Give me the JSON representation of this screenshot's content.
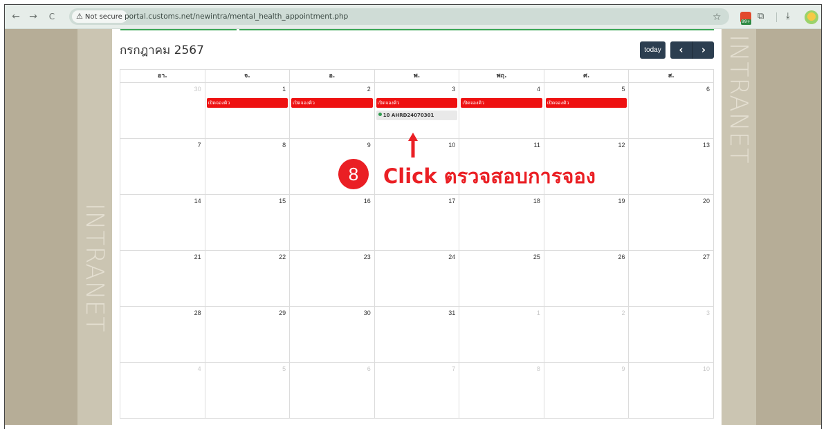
{
  "browser": {
    "nav_back": "←",
    "nav_forward": "→",
    "reload": "C",
    "security_label": "Not secure",
    "security_icon": "warning-triangle-icon",
    "url": "portal.customs.net/newintra/mental_health_appointment.php",
    "extension_badge": "99+"
  },
  "watermark": "INTRANET",
  "calendar": {
    "title": "กรกฎาคม 2567",
    "today_label": "today",
    "prev_label": "‹",
    "next_label": "›",
    "weekdays": [
      "อา.",
      "จ.",
      "อ.",
      "พ.",
      "พฤ.",
      "ศ.",
      "ส."
    ],
    "weeks": [
      [
        {
          "day": "30",
          "other": true
        },
        {
          "day": "1",
          "event": "เปิดจองคิว"
        },
        {
          "day": "2",
          "event": "เปิดจองคิว"
        },
        {
          "day": "3",
          "event": "เปิดจองคิว",
          "booking": "10 AHRD24070301"
        },
        {
          "day": "4",
          "event": "เปิดจองคิว"
        },
        {
          "day": "5",
          "event": "เปิดจองคิว"
        },
        {
          "day": "6"
        }
      ],
      [
        {
          "day": "7"
        },
        {
          "day": "8"
        },
        {
          "day": "9"
        },
        {
          "day": "10"
        },
        {
          "day": "11"
        },
        {
          "day": "12"
        },
        {
          "day": "13"
        }
      ],
      [
        {
          "day": "14"
        },
        {
          "day": "15"
        },
        {
          "day": "16"
        },
        {
          "day": "17"
        },
        {
          "day": "18"
        },
        {
          "day": "19"
        },
        {
          "day": "20"
        }
      ],
      [
        {
          "day": "21"
        },
        {
          "day": "22"
        },
        {
          "day": "23"
        },
        {
          "day": "24"
        },
        {
          "day": "25"
        },
        {
          "day": "26"
        },
        {
          "day": "27"
        }
      ],
      [
        {
          "day": "28"
        },
        {
          "day": "29"
        },
        {
          "day": "30"
        },
        {
          "day": "31"
        },
        {
          "day": "1",
          "other": true
        },
        {
          "day": "2",
          "other": true
        },
        {
          "day": "3",
          "other": true
        }
      ],
      [
        {
          "day": "4",
          "other": true
        },
        {
          "day": "5",
          "other": true
        },
        {
          "day": "6",
          "other": true
        },
        {
          "day": "7",
          "other": true
        },
        {
          "day": "8",
          "other": true
        },
        {
          "day": "9",
          "other": true
        },
        {
          "day": "10",
          "other": true
        }
      ]
    ]
  },
  "instruction": {
    "step": "8",
    "text": "Click ตรวจสอบการจอง"
  },
  "colors": {
    "accent_red": "#ea1f24",
    "event_red": "#ee1111",
    "button_dark": "#2c3e50",
    "top_line_green": "#3aa655"
  }
}
